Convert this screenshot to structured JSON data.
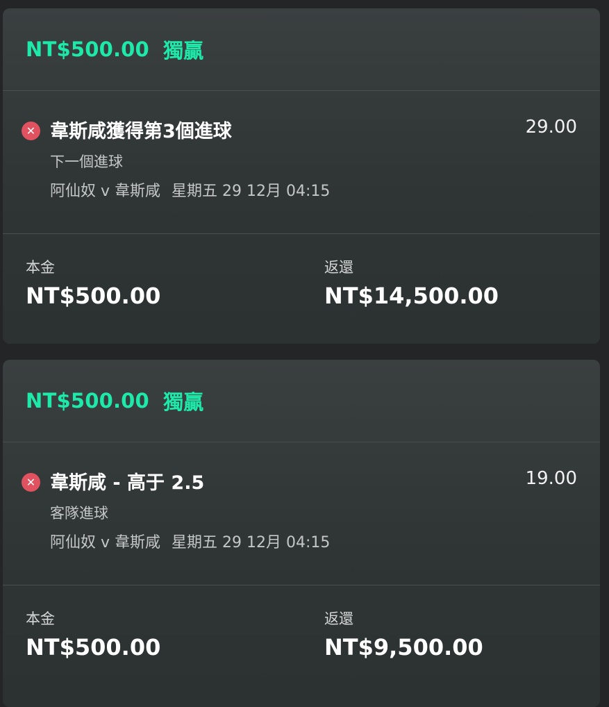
{
  "bets": [
    {
      "header_stake": "NT$500.00",
      "header_type": "獨贏",
      "status_icon": "close-icon",
      "selection": "韋斯咸獲得第3個進球",
      "odds": "29.00",
      "market": "下一個進球",
      "event": "阿仙奴 v 韋斯咸",
      "date": "星期五 29 12月 04:15",
      "stake_label": "本金",
      "stake_value": "NT$500.00",
      "returns_label": "返還",
      "returns_value": "NT$14,500.00"
    },
    {
      "header_stake": "NT$500.00",
      "header_type": "獨贏",
      "status_icon": "close-icon",
      "selection": "韋斯咸 - 高于 2.5",
      "odds": "19.00",
      "market": "客隊進球",
      "event": "阿仙奴 v 韋斯咸",
      "date": "星期五 29 12月 04:15",
      "stake_label": "本金",
      "stake_value": "NT$500.00",
      "returns_label": "返還",
      "returns_value": "NT$9,500.00"
    }
  ],
  "colors": {
    "accent": "#1de9a8",
    "lost": "#e0525f",
    "card": "#323838",
    "background": "#242526"
  }
}
